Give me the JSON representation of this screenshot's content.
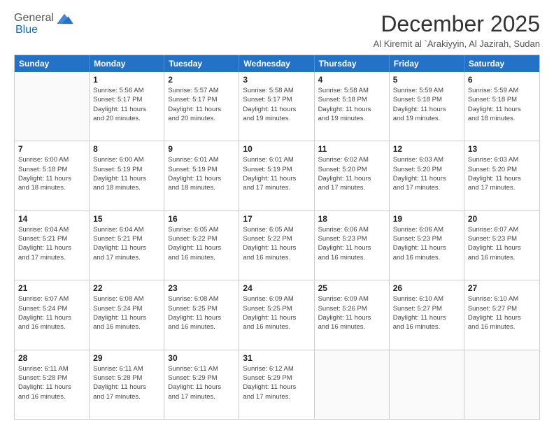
{
  "header": {
    "logo_general": "General",
    "logo_blue": "Blue",
    "month_title": "December 2025",
    "location": "Al Kiremit al `Arakiyyin, Al Jazirah, Sudan"
  },
  "calendar": {
    "days_of_week": [
      "Sunday",
      "Monday",
      "Tuesday",
      "Wednesday",
      "Thursday",
      "Friday",
      "Saturday"
    ],
    "rows": [
      [
        {
          "day": "",
          "lines": []
        },
        {
          "day": "1",
          "lines": [
            "Sunrise: 5:56 AM",
            "Sunset: 5:17 PM",
            "Daylight: 11 hours",
            "and 20 minutes."
          ]
        },
        {
          "day": "2",
          "lines": [
            "Sunrise: 5:57 AM",
            "Sunset: 5:17 PM",
            "Daylight: 11 hours",
            "and 20 minutes."
          ]
        },
        {
          "day": "3",
          "lines": [
            "Sunrise: 5:58 AM",
            "Sunset: 5:17 PM",
            "Daylight: 11 hours",
            "and 19 minutes."
          ]
        },
        {
          "day": "4",
          "lines": [
            "Sunrise: 5:58 AM",
            "Sunset: 5:18 PM",
            "Daylight: 11 hours",
            "and 19 minutes."
          ]
        },
        {
          "day": "5",
          "lines": [
            "Sunrise: 5:59 AM",
            "Sunset: 5:18 PM",
            "Daylight: 11 hours",
            "and 19 minutes."
          ]
        },
        {
          "day": "6",
          "lines": [
            "Sunrise: 5:59 AM",
            "Sunset: 5:18 PM",
            "Daylight: 11 hours",
            "and 18 minutes."
          ]
        }
      ],
      [
        {
          "day": "7",
          "lines": [
            "Sunrise: 6:00 AM",
            "Sunset: 5:18 PM",
            "Daylight: 11 hours",
            "and 18 minutes."
          ]
        },
        {
          "day": "8",
          "lines": [
            "Sunrise: 6:00 AM",
            "Sunset: 5:19 PM",
            "Daylight: 11 hours",
            "and 18 minutes."
          ]
        },
        {
          "day": "9",
          "lines": [
            "Sunrise: 6:01 AM",
            "Sunset: 5:19 PM",
            "Daylight: 11 hours",
            "and 18 minutes."
          ]
        },
        {
          "day": "10",
          "lines": [
            "Sunrise: 6:01 AM",
            "Sunset: 5:19 PM",
            "Daylight: 11 hours",
            "and 17 minutes."
          ]
        },
        {
          "day": "11",
          "lines": [
            "Sunrise: 6:02 AM",
            "Sunset: 5:20 PM",
            "Daylight: 11 hours",
            "and 17 minutes."
          ]
        },
        {
          "day": "12",
          "lines": [
            "Sunrise: 6:03 AM",
            "Sunset: 5:20 PM",
            "Daylight: 11 hours",
            "and 17 minutes."
          ]
        },
        {
          "day": "13",
          "lines": [
            "Sunrise: 6:03 AM",
            "Sunset: 5:20 PM",
            "Daylight: 11 hours",
            "and 17 minutes."
          ]
        }
      ],
      [
        {
          "day": "14",
          "lines": [
            "Sunrise: 6:04 AM",
            "Sunset: 5:21 PM",
            "Daylight: 11 hours",
            "and 17 minutes."
          ]
        },
        {
          "day": "15",
          "lines": [
            "Sunrise: 6:04 AM",
            "Sunset: 5:21 PM",
            "Daylight: 11 hours",
            "and 17 minutes."
          ]
        },
        {
          "day": "16",
          "lines": [
            "Sunrise: 6:05 AM",
            "Sunset: 5:22 PM",
            "Daylight: 11 hours",
            "and 16 minutes."
          ]
        },
        {
          "day": "17",
          "lines": [
            "Sunrise: 6:05 AM",
            "Sunset: 5:22 PM",
            "Daylight: 11 hours",
            "and 16 minutes."
          ]
        },
        {
          "day": "18",
          "lines": [
            "Sunrise: 6:06 AM",
            "Sunset: 5:23 PM",
            "Daylight: 11 hours",
            "and 16 minutes."
          ]
        },
        {
          "day": "19",
          "lines": [
            "Sunrise: 6:06 AM",
            "Sunset: 5:23 PM",
            "Daylight: 11 hours",
            "and 16 minutes."
          ]
        },
        {
          "day": "20",
          "lines": [
            "Sunrise: 6:07 AM",
            "Sunset: 5:23 PM",
            "Daylight: 11 hours",
            "and 16 minutes."
          ]
        }
      ],
      [
        {
          "day": "21",
          "lines": [
            "Sunrise: 6:07 AM",
            "Sunset: 5:24 PM",
            "Daylight: 11 hours",
            "and 16 minutes."
          ]
        },
        {
          "day": "22",
          "lines": [
            "Sunrise: 6:08 AM",
            "Sunset: 5:24 PM",
            "Daylight: 11 hours",
            "and 16 minutes."
          ]
        },
        {
          "day": "23",
          "lines": [
            "Sunrise: 6:08 AM",
            "Sunset: 5:25 PM",
            "Daylight: 11 hours",
            "and 16 minutes."
          ]
        },
        {
          "day": "24",
          "lines": [
            "Sunrise: 6:09 AM",
            "Sunset: 5:25 PM",
            "Daylight: 11 hours",
            "and 16 minutes."
          ]
        },
        {
          "day": "25",
          "lines": [
            "Sunrise: 6:09 AM",
            "Sunset: 5:26 PM",
            "Daylight: 11 hours",
            "and 16 minutes."
          ]
        },
        {
          "day": "26",
          "lines": [
            "Sunrise: 6:10 AM",
            "Sunset: 5:27 PM",
            "Daylight: 11 hours",
            "and 16 minutes."
          ]
        },
        {
          "day": "27",
          "lines": [
            "Sunrise: 6:10 AM",
            "Sunset: 5:27 PM",
            "Daylight: 11 hours",
            "and 16 minutes."
          ]
        }
      ],
      [
        {
          "day": "28",
          "lines": [
            "Sunrise: 6:11 AM",
            "Sunset: 5:28 PM",
            "Daylight: 11 hours",
            "and 16 minutes."
          ]
        },
        {
          "day": "29",
          "lines": [
            "Sunrise: 6:11 AM",
            "Sunset: 5:28 PM",
            "Daylight: 11 hours",
            "and 17 minutes."
          ]
        },
        {
          "day": "30",
          "lines": [
            "Sunrise: 6:11 AM",
            "Sunset: 5:29 PM",
            "Daylight: 11 hours",
            "and 17 minutes."
          ]
        },
        {
          "day": "31",
          "lines": [
            "Sunrise: 6:12 AM",
            "Sunset: 5:29 PM",
            "Daylight: 11 hours",
            "and 17 minutes."
          ]
        },
        {
          "day": "",
          "lines": []
        },
        {
          "day": "",
          "lines": []
        },
        {
          "day": "",
          "lines": []
        }
      ]
    ]
  }
}
